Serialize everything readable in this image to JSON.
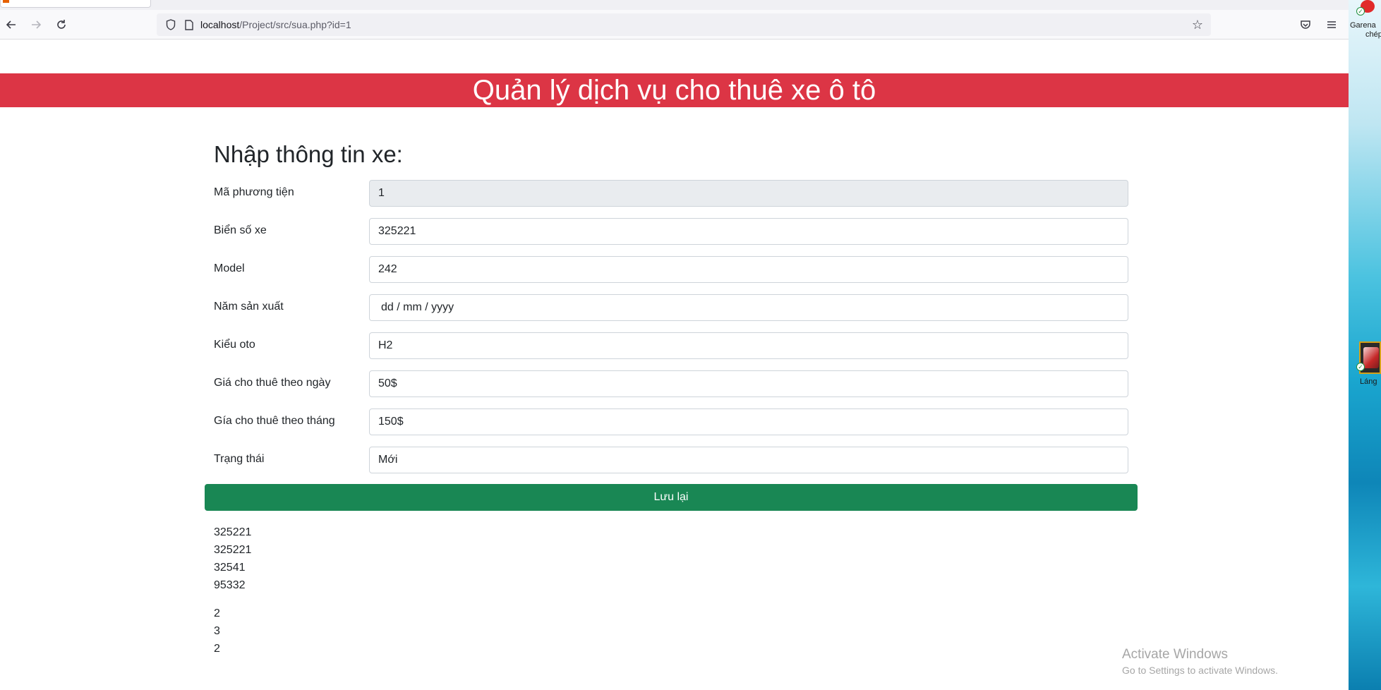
{
  "browser": {
    "url_host": "localhost",
    "url_path": "/Project/src/sua.php?id=1"
  },
  "desktop": {
    "icon1_label_line1": "Garena",
    "icon1_label_line2": "chép",
    "icon2_label": "Láng"
  },
  "header": {
    "title": "Quản lý dịch vụ cho thuê xe ô tô"
  },
  "form": {
    "title": "Nhập thông tin xe:",
    "fields": [
      {
        "label": "Mã phương tiện",
        "value": "1",
        "readonly": true
      },
      {
        "label": "Biển số xe",
        "value": "325221"
      },
      {
        "label": "Model",
        "value": "242"
      },
      {
        "label": "Năm sản xuất",
        "value": "dd / mm / yyyy"
      },
      {
        "label": "Kiểu oto",
        "value": "H2"
      },
      {
        "label": "Giá cho thuê theo ngày",
        "value": "50$"
      },
      {
        "label": "Gía cho thuê theo tháng",
        "value": "150$"
      },
      {
        "label": "Trạng thái",
        "value": "Mới"
      }
    ],
    "submit_label": "Lưu lại"
  },
  "list1": [
    "325221",
    "325221",
    "32541",
    "95332"
  ],
  "list2": [
    "2",
    "3",
    "2"
  ],
  "watermark": {
    "title": "Activate Windows",
    "subtitle": "Go to Settings to activate Windows."
  }
}
